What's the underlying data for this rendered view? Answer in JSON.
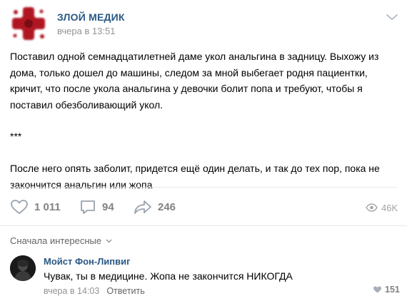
{
  "post": {
    "author": "ЗЛОЙ МЕДИК",
    "time": "вчера в 13:51",
    "paragraphs": [
      "Поставил одной семнадцатилетней даме укол анальгина в задницу. Выхожу из дома, только дошел до машины, следом за мной выбегает родня пациентки, кричит, что после укола анальгина у девочки болит попа и требуют, чтобы я поставил обезболивающий укол.",
      "***",
      "После него опять заболит, придется ещё один делать, и так до тех пор, пока не закончится анальгин или жопа"
    ],
    "likes": "1 011",
    "comments": "94",
    "shares": "246",
    "views": "46K"
  },
  "comments_section": {
    "sort_label": "Сначала интересные",
    "comment": {
      "author": "Мойст Фон-Липвиг",
      "text": "Чувак, ты в медицине. Жопа не закончится НИКОГДА",
      "time": "вчера в 14:03",
      "reply_label": "Ответить",
      "likes": "151"
    }
  },
  "colors": {
    "link": "#2a5885",
    "muted": "#828282",
    "avatar_red": "#b01822"
  },
  "icons": [
    "red-cross-avatar-icon",
    "chevron-down-icon",
    "heart-icon",
    "comment-icon",
    "share-icon",
    "eye-icon",
    "small-chevron-icon",
    "small-heart-icon"
  ]
}
